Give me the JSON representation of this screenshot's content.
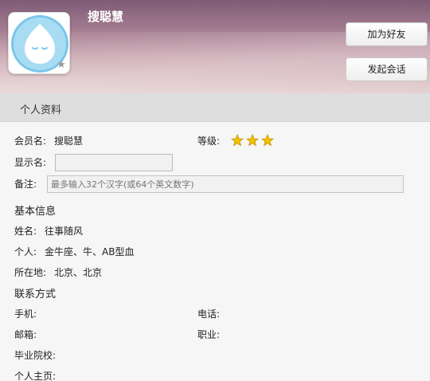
{
  "header": {
    "name": "搜聪慧",
    "add_friend": "加为好友",
    "start_chat": "发起会话"
  },
  "section": {
    "title": "个人资料"
  },
  "profile": {
    "member_label": "会员名:",
    "member_value": "搜聪慧",
    "level_label": "等级:",
    "level_stars": 3,
    "display_label": "显示名:",
    "display_value": "",
    "note_label": "备注:",
    "note_placeholder": "最多输入32个汉字(或64个英文数字)"
  },
  "basic": {
    "title": "基本信息",
    "name_label": "姓名:",
    "name_value": "往事随风",
    "personal_label": "个人:",
    "personal_value": "金牛座、牛、AB型血",
    "location_label": "所在地:",
    "location_value": "北京、北京"
  },
  "contact": {
    "title": "联系方式",
    "mobile_label": "手机:",
    "phone_label": "电话:",
    "email_label": "邮箱:",
    "job_label": "职业:",
    "school_label": "毕业院校:",
    "homepage_label": "个人主页:"
  },
  "colors": {
    "star": "#f2c300",
    "header_top": "#7d5c75",
    "section_bar": "#dedede"
  }
}
